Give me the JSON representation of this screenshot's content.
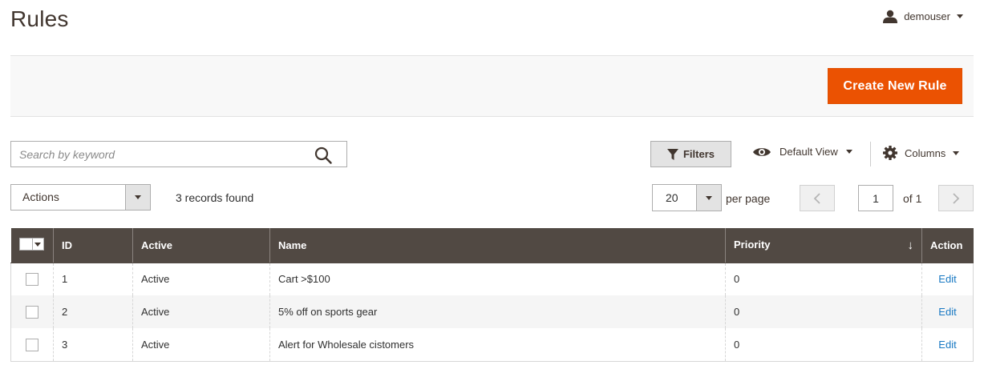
{
  "page": {
    "title": "Rules"
  },
  "header": {
    "username": "demouser"
  },
  "action_bar": {
    "create_label": "Create New Rule"
  },
  "toolbar": {
    "search_placeholder": "Search by keyword",
    "filters_label": "Filters",
    "view_label": "Default View",
    "columns_label": "Columns"
  },
  "mass_actions": {
    "label": "Actions"
  },
  "records_found": "3 records found",
  "pagination": {
    "per_page_value": "20",
    "per_page_label": "per page",
    "current_page": "1",
    "of_label": "of 1"
  },
  "table": {
    "columns": {
      "id": "ID",
      "active": "Active",
      "name": "Name",
      "priority": "Priority",
      "action": "Action"
    },
    "sort_indicator": "↓",
    "rows": [
      {
        "id": "1",
        "active": "Active",
        "name": "Cart >$100",
        "priority": "0",
        "action": "Edit"
      },
      {
        "id": "2",
        "active": "Active",
        "name": "5% off on sports gear",
        "priority": "0",
        "action": "Edit"
      },
      {
        "id": "3",
        "active": "Active",
        "name": "Alert for Wholesale cistomers",
        "priority": "0",
        "action": "Edit"
      }
    ]
  },
  "colors": {
    "accent": "#eb5202",
    "header_bg": "#514943",
    "link": "#1979c3"
  },
  "icons": [
    "user-icon",
    "search-icon",
    "filter-icon",
    "eye-icon",
    "gear-icon",
    "chevron-left-icon",
    "chevron-right-icon"
  ]
}
